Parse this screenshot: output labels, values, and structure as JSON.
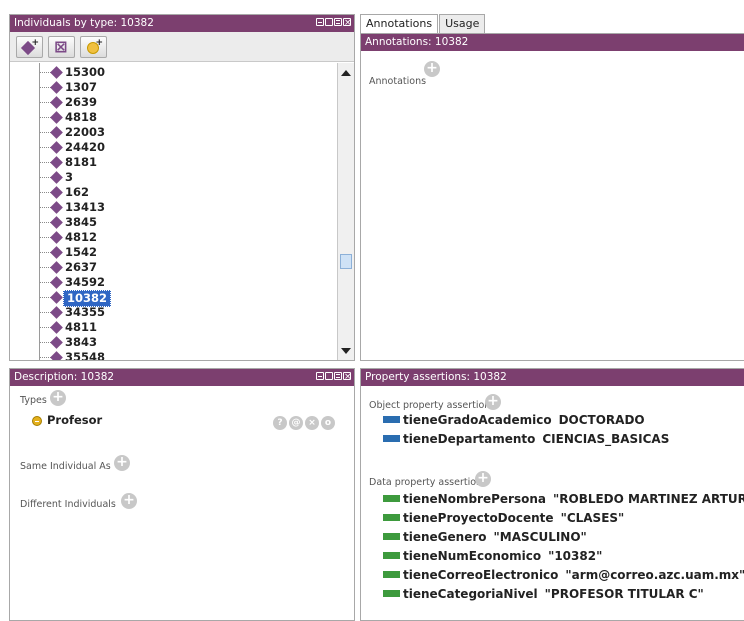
{
  "individuals_panel": {
    "title": "Individuals by type: 10382",
    "toolbar": {
      "add_icon": "add-individual-icon",
      "delete_icon": "delete-individual-icon",
      "add_same_icon": "add-same-individual-icon"
    },
    "tree_items": [
      "15300",
      "1307",
      "2639",
      "4818",
      "22003",
      "24420",
      "8181",
      "3",
      "162",
      "13413",
      "3845",
      "4812",
      "1542",
      "2637",
      "34592",
      "10382",
      "34355",
      "4811",
      "3843",
      "35548"
    ],
    "selected": "10382"
  },
  "annotations_panel": {
    "tabs": [
      "Annotations",
      "Usage"
    ],
    "title": "Annotations: 10382",
    "annotations_label": "Annotations"
  },
  "description_panel": {
    "title": "Description: 10382",
    "types_label": "Types",
    "type_value": "Profesor",
    "row_buttons": [
      "?",
      "@",
      "×",
      "o"
    ],
    "same_label": "Same Individual As",
    "different_label": "Different Individuals"
  },
  "property_panel": {
    "title": "Property assertions: 10382",
    "object_label": "Object property assertions",
    "object_rows": [
      {
        "prop": "tieneGradoAcademico",
        "value": "DOCTORADO"
      },
      {
        "prop": "tieneDepartamento",
        "value": "CIENCIAS_BASICAS"
      }
    ],
    "data_label": "Data property assertions",
    "data_rows": [
      {
        "prop": "tieneNombrePersona",
        "value": "\"ROBLEDO MARTINEZ ARTURO\""
      },
      {
        "prop": "tieneProyectoDocente",
        "value": "\"CLASES\""
      },
      {
        "prop": "tieneGenero",
        "value": "\"MASCULINO\""
      },
      {
        "prop": "tieneNumEconomico",
        "value": "\"10382\""
      },
      {
        "prop": "tieneCorreoElectronico",
        "value": "\"arm@correo.azc.uam.mx\""
      },
      {
        "prop": "tieneCategoriaNivel",
        "value": "\"PROFESOR TITULAR C\""
      }
    ]
  },
  "colors": {
    "header": "#7c3f6f",
    "individual": "#7c4a87",
    "object_property": "#2a6db0",
    "data_property": "#3d9a3d",
    "selection": "#2f66c4"
  }
}
